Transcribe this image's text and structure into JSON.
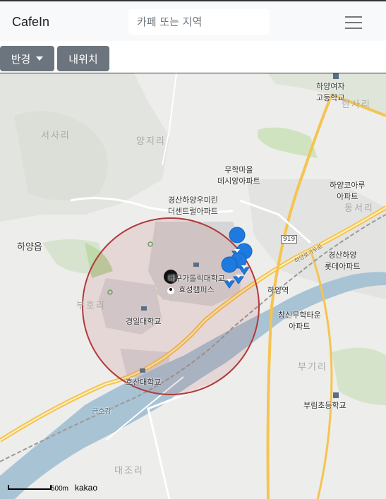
{
  "navbar": {
    "brand": "CafeIn",
    "search_placeholder": "카페 또는 지역"
  },
  "toolbar": {
    "radius_label": "반경",
    "my_location_label": "내위치"
  },
  "map": {
    "labels": {
      "hayang_girls_high": [
        "하양여자",
        "고등학교"
      ],
      "hansari": "한사리",
      "seosari": "서사리",
      "yangjiri": "양지리",
      "muhak_apt": [
        "무학마을",
        "데시앙아파트"
      ],
      "hayang_koaru": [
        "하양코아루",
        "아파트"
      ],
      "dongseori": "동서리",
      "umirin_apt": [
        "경산하양우미린",
        "더센트럴아파트"
      ],
      "hayang_eup": "하양읍",
      "route_919": "919",
      "hayang_lotte": [
        "경산하양",
        "롯데아파트"
      ],
      "catholic_univ": [
        "대구가톨릭대학교",
        "효성캠퍼스"
      ],
      "hayang_station": "하양역",
      "bohori": "부호리",
      "kyungil_univ": "경일대학교",
      "sinmuhak_apt": [
        "창신무학타운",
        "아파트"
      ],
      "bugiri": "부기리",
      "hoseo_univ": "호산대학교",
      "geumho_river": "금호강",
      "burim_school": "부림초등학교",
      "daejori": "대조리",
      "road_name": "하양로가두로"
    },
    "scale": "500m",
    "attribution": "kakao",
    "search_radius_color": "#b03a3a",
    "marker_color": "#1f7ae0"
  }
}
